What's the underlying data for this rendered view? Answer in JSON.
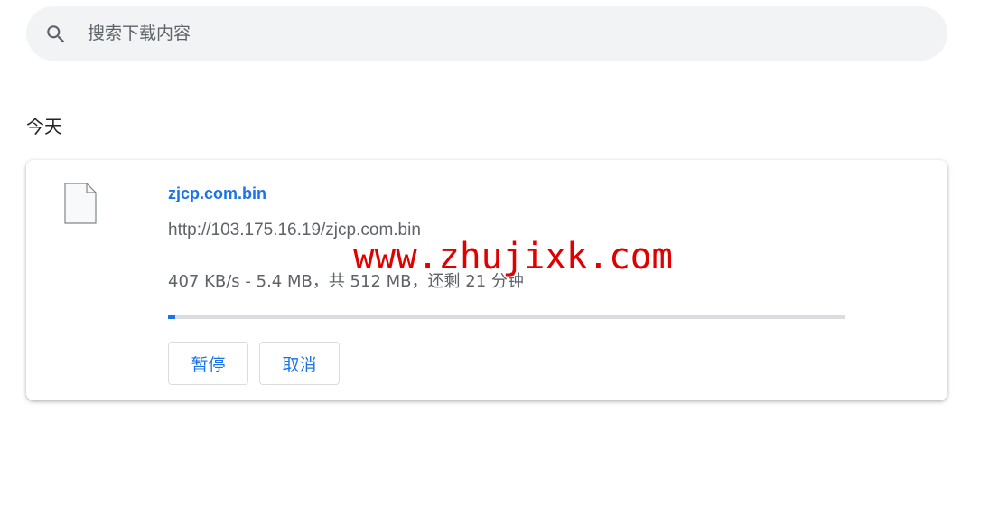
{
  "search": {
    "placeholder": "搜索下载内容",
    "icon": "search-icon"
  },
  "section": {
    "title": "今天"
  },
  "download": {
    "file_name": "zjcp.com.bin",
    "url": "http://103.175.16.19/zjcp.com.bin",
    "progress_text": "407 KB/s - 5.4 MB，共 512 MB，还剩 21 分钟",
    "progress_fraction": 0.0105,
    "file_icon": "file-icon",
    "pause_label": "暂停",
    "cancel_label": "取消"
  },
  "watermark": {
    "text": "www.zhujixk.com"
  },
  "colors": {
    "accent": "#1a73e8",
    "search_bg": "#f1f3f4",
    "watermark": "#e00000",
    "progress_track": "#dadce0"
  }
}
